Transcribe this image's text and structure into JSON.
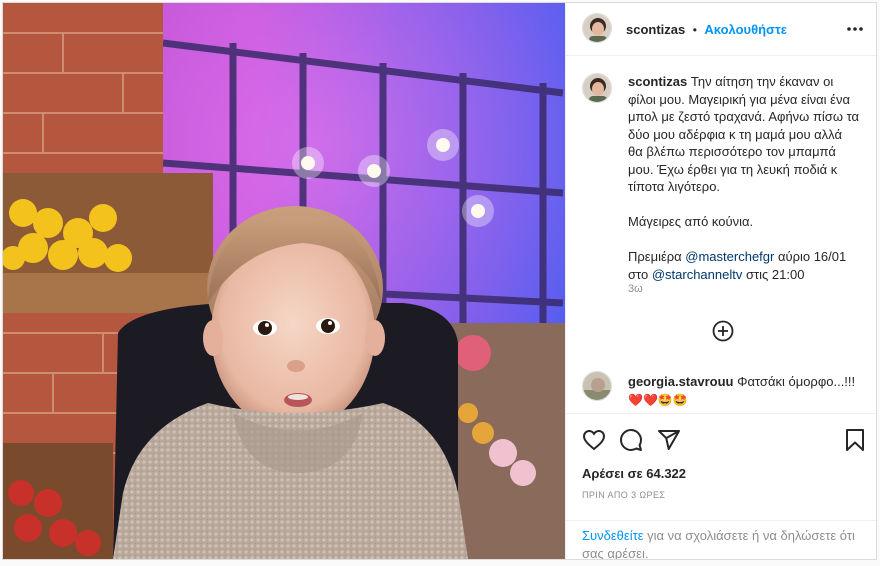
{
  "post": {
    "author": "scontizas",
    "separator": "•",
    "follow_label": "Ακολουθήστε",
    "more_icon": "more-options-icon",
    "caption_author": "scontizas",
    "caption_text": "Την αίτηση την έκαναν οι φίλοι μου. Μαγειρική για μένα είναι ένα μπολ με ζεστό τραχανά. Αφήνω πίσω τα δύο μου αδέρφια κ τη μαμά μου αλλά θα βλέπω περισσότερο τον μπαμπά μου. Έχω έρθει για τη λευκή ποδιά κ τίποτα λιγότερο.",
    "caption_line2": "Μάγειρες από κούνια.",
    "caption_line3_pre": "Πρεμιέρα ",
    "caption_mention1": "@masterchefgr",
    "caption_line3_mid": " αύριο 16/01 στο ",
    "caption_mention2": "@starchanneltv",
    "caption_line3_post": " στις 21:00",
    "age": "3ω",
    "load_more_icon": "add-circle-icon",
    "comment": {
      "user": "georgia.stavrouu",
      "text": "Φατσάκι όμορφο...!!!",
      "emojis": "❤️❤️🤩🤩"
    },
    "likes": "Αρέσει σε 64.322",
    "timestamp": "ΠΡΙΝ ΑΠΟ 3 ΩΡΕΣ",
    "login_link": "Συνδεθείτε",
    "login_text": " για να σχολιάσετε ή να δηλώσετε ότι σας αρέσει."
  },
  "colors": {
    "accent": "#0095f6",
    "text": "#262626",
    "muted": "#8e8e8e",
    "mention": "#00376b"
  }
}
